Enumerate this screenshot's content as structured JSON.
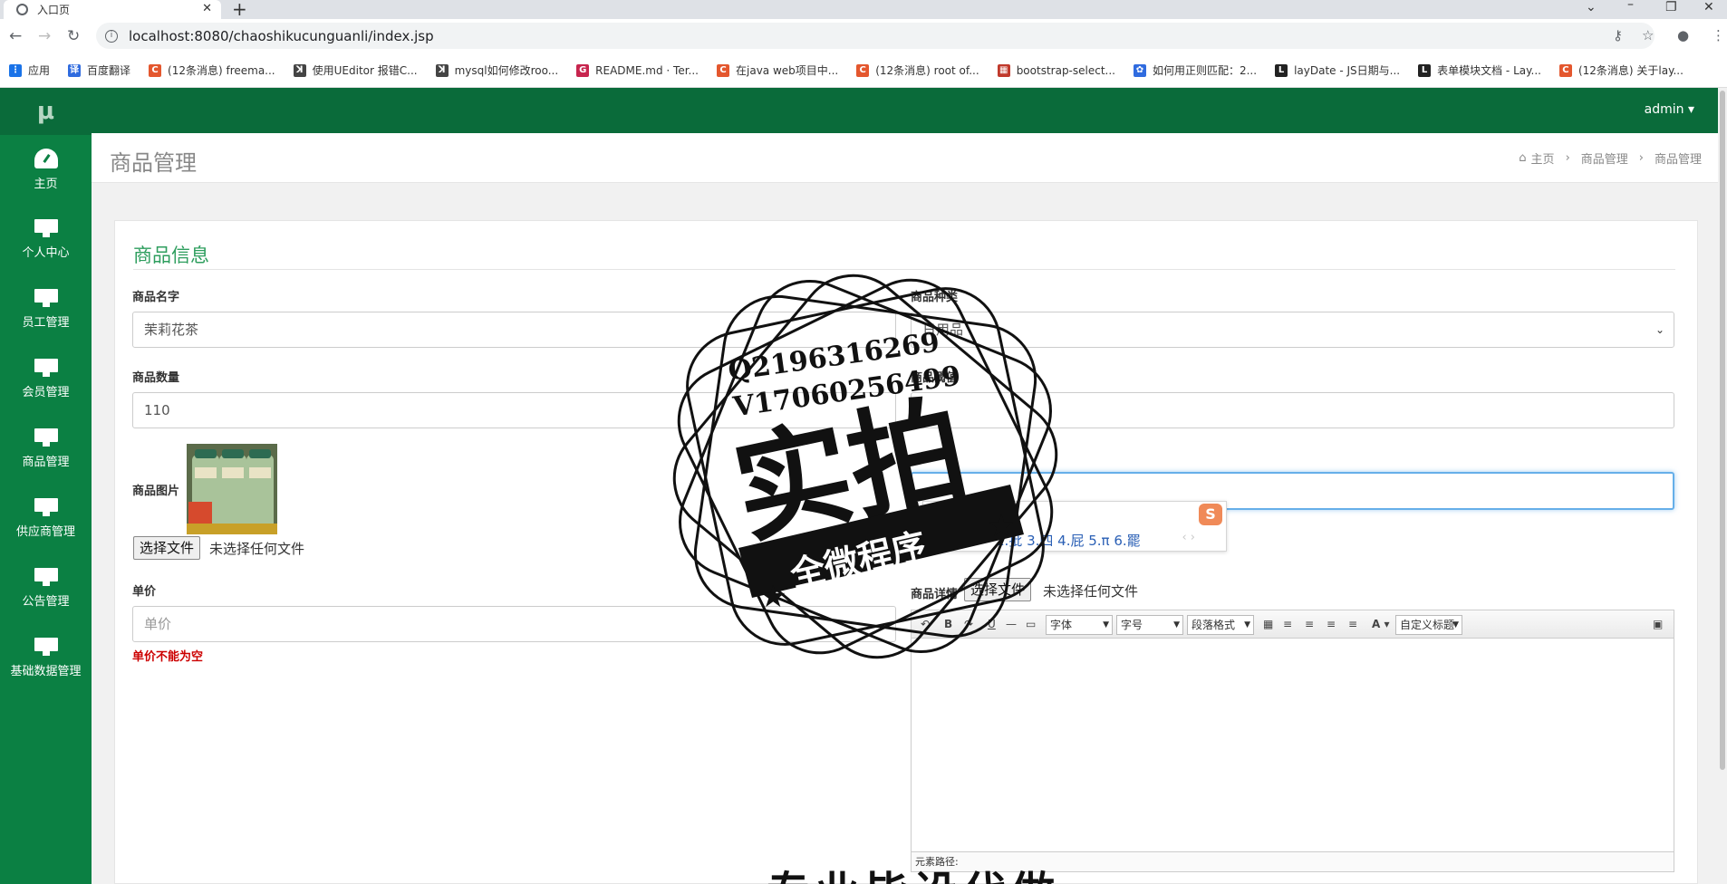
{
  "browser": {
    "tab_title": "入口页",
    "url": "localhost:8080/chaoshikucunguanli/index.jsp",
    "bookmarks": [
      {
        "label": "应用",
        "color": "#1a73e8",
        "glyph": "⋮"
      },
      {
        "label": "百度翻译",
        "color": "#2f6bdf",
        "glyph": "译"
      },
      {
        "label": "(12条消息) freema...",
        "color": "#e4572e",
        "glyph": "C"
      },
      {
        "label": "使用UEditor 报错C...",
        "color": "#444444",
        "glyph": "ꓘ"
      },
      {
        "label": "mysql如何修改roo...",
        "color": "#444444",
        "glyph": "ꓘ"
      },
      {
        "label": "README.md · Ter...",
        "color": "#c7254e",
        "glyph": "G"
      },
      {
        "label": "在java web项目中...",
        "color": "#e4572e",
        "glyph": "C"
      },
      {
        "label": "(12条消息) root of...",
        "color": "#e4572e",
        "glyph": "C"
      },
      {
        "label": "bootstrap-select...",
        "color": "#c0392b",
        "glyph": "▦"
      },
      {
        "label": "如何用正则匹配：2...",
        "color": "#2f6bdf",
        "glyph": "✿"
      },
      {
        "label": "layDate - JS日期与...",
        "color": "#222222",
        "glyph": "L"
      },
      {
        "label": "表单模块文档 - Lay...",
        "color": "#222222",
        "glyph": "L"
      },
      {
        "label": "(12条消息) 关于lay...",
        "color": "#e4572e",
        "glyph": "C"
      }
    ]
  },
  "sidebar": {
    "logo": "μ",
    "items": [
      {
        "label": "主页",
        "icon": "dashboard-icon"
      },
      {
        "label": "个人中心",
        "icon": "monitor-icon"
      },
      {
        "label": "员工管理",
        "icon": "monitor-icon"
      },
      {
        "label": "会员管理",
        "icon": "monitor-icon"
      },
      {
        "label": "商品管理",
        "icon": "monitor-icon"
      },
      {
        "label": "供应商管理",
        "icon": "monitor-icon"
      },
      {
        "label": "公告管理",
        "icon": "monitor-icon"
      },
      {
        "label": "基础数据管理",
        "icon": "monitor-icon"
      }
    ]
  },
  "topbar": {
    "user": "admin ▾"
  },
  "header": {
    "title": "商品管理",
    "breadcrumb": [
      "主页",
      "商品管理",
      "商品管理"
    ]
  },
  "form": {
    "section_title": "商品信息",
    "name": {
      "label": "商品名字",
      "value": "茉莉花茶"
    },
    "category": {
      "label": "商品种类",
      "value": "日用品"
    },
    "quantity": {
      "label": "商品数量",
      "value": "110"
    },
    "threshold": {
      "label": "商品阈值",
      "value": ""
    },
    "image": {
      "label": "商品图片",
      "button": "选择文件",
      "status": "未选择任何文件"
    },
    "price": {
      "label": "单价",
      "placeholder": "单价",
      "error": "单价不能为空"
    },
    "detail": {
      "label": "商品详情",
      "button": "选择文件",
      "status": "未选择任何文件"
    }
  },
  "ime": {
    "pinyin": "pi",
    "candidates": "1.批  3.四  4.屁  5.π  6.罷",
    "nav": "‹ ›",
    "logo": "S"
  },
  "editor": {
    "font_combo": "字体",
    "size_combo": "字号",
    "para_combo": "段落格式",
    "custom_combo": "自定义标题",
    "footer": "元素路径:"
  },
  "watermark": {
    "line1": "Q2196316269",
    "line2": "V17060256499",
    "big": "实拍",
    "ribbon": "全微程序",
    "bottom": "专业毕设代做"
  }
}
